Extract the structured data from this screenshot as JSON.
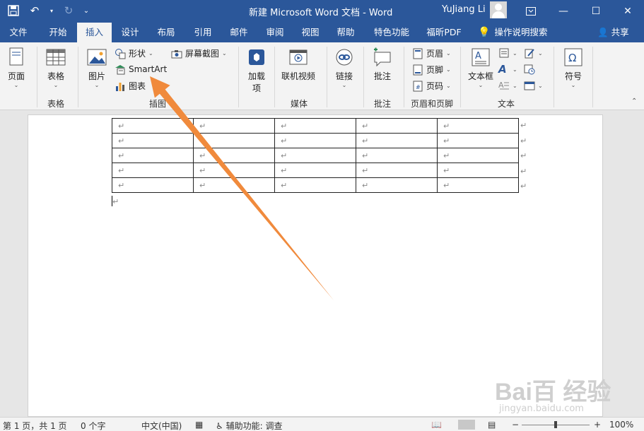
{
  "titlebar": {
    "title": "新建 Microsoft Word 文档  -  Word",
    "user": "YuJiang Li",
    "minimize": "—",
    "maximize": "☐",
    "close": "✕"
  },
  "tabs": {
    "items": [
      {
        "label": "文件"
      },
      {
        "label": "开始"
      },
      {
        "label": "插入"
      },
      {
        "label": "设计"
      },
      {
        "label": "布局"
      },
      {
        "label": "引用"
      },
      {
        "label": "邮件"
      },
      {
        "label": "审阅"
      },
      {
        "label": "视图"
      },
      {
        "label": "帮助"
      },
      {
        "label": "特色功能"
      },
      {
        "label": "福昕PDF"
      },
      {
        "label": "操作说明搜索"
      }
    ],
    "active": "插入",
    "share": "共享"
  },
  "ribbon": {
    "pages": {
      "label": "页面"
    },
    "tables": {
      "label": "表格",
      "group": "表格"
    },
    "illustrations": {
      "picture": "图片",
      "shapes": "形状",
      "smartart": "SmartArt",
      "chart": "图表",
      "screenshot": "屏幕截图",
      "group": "插图"
    },
    "addins": {
      "label1": "加载",
      "label2": "项"
    },
    "media": {
      "online_video": "联机视频",
      "group": "媒体"
    },
    "links": {
      "label": "链接"
    },
    "comments": {
      "comment": "批注",
      "group": "批注"
    },
    "header_footer": {
      "header": "页眉",
      "footer": "页脚",
      "page_number": "页码",
      "group": "页眉和页脚"
    },
    "text": {
      "textbox": "文本框",
      "group": "文本"
    },
    "symbols": {
      "label": "符号"
    }
  },
  "document": {
    "para_mark": "↵",
    "rows": 5,
    "cols": 5
  },
  "status": {
    "page": "第 1 页，共 1 页",
    "words": "0 个字",
    "language": "中文(中国)",
    "accessibility": "辅助功能: 调查",
    "zoom": "100%"
  },
  "watermark": {
    "main": "Bai百 经验",
    "sub": "jingyan.baidu.com"
  },
  "colors": {
    "accent": "#2b579a",
    "arrow": "#f08a3c"
  }
}
